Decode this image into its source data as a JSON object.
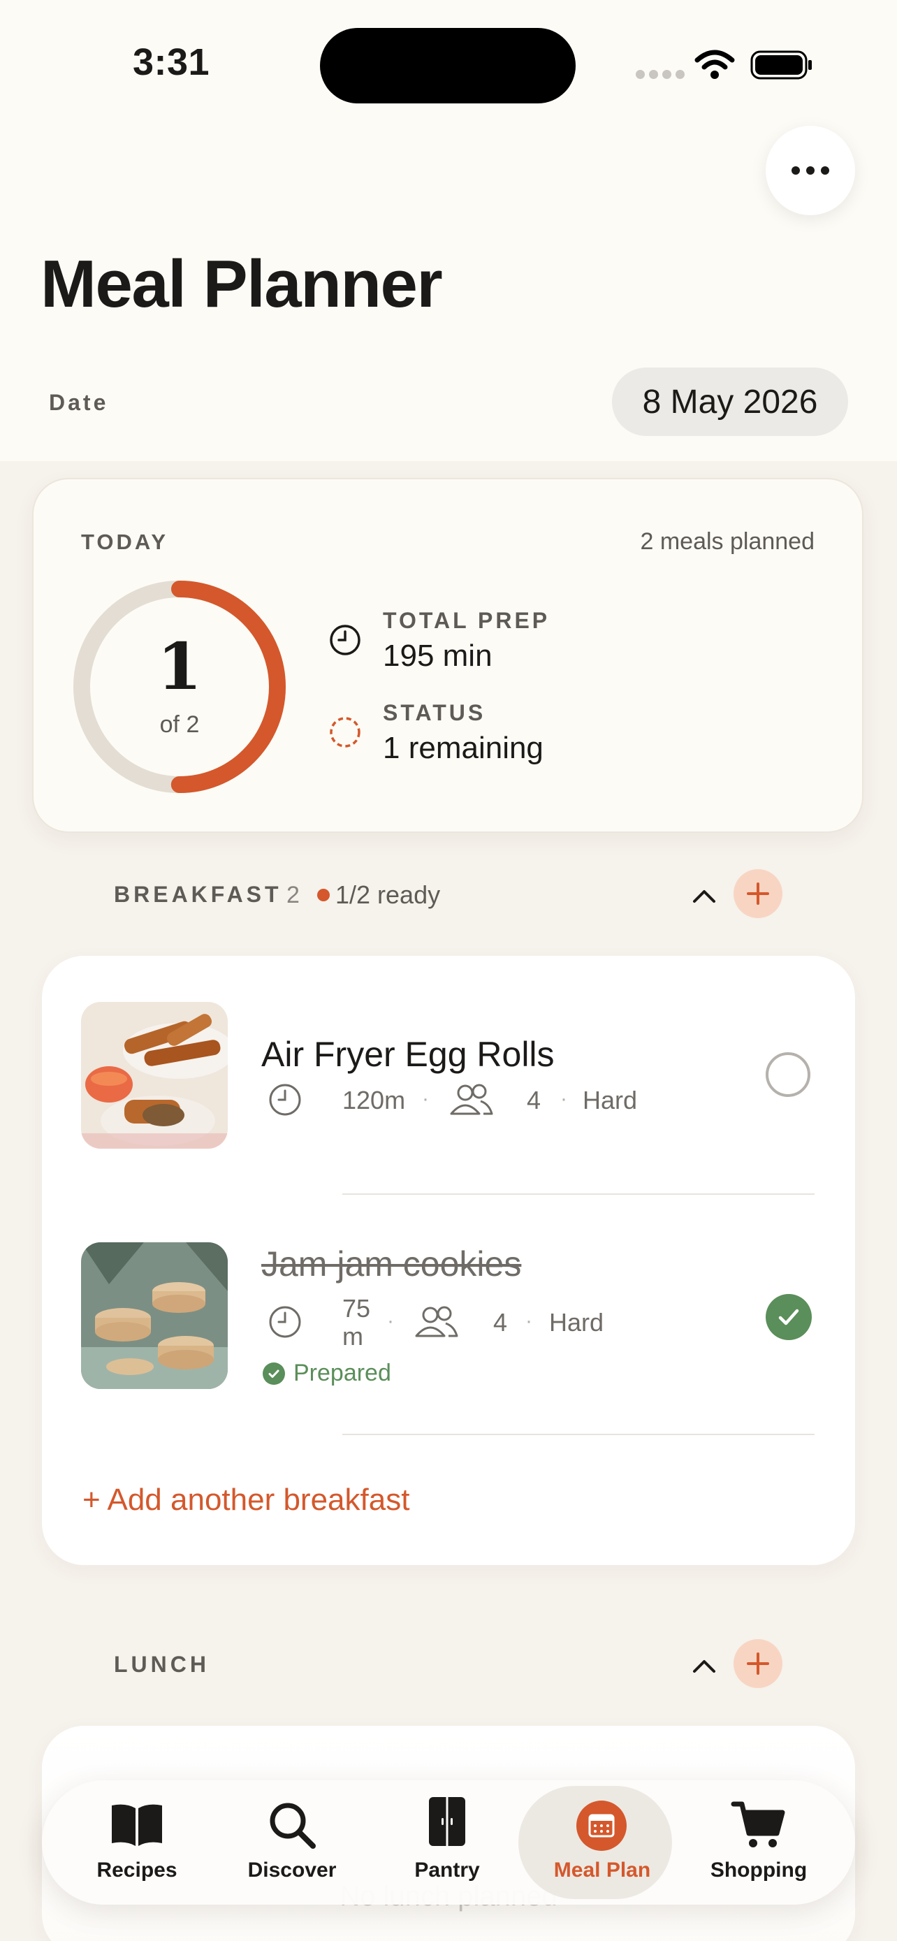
{
  "status_bar": {
    "time": "3:31"
  },
  "header": {
    "title": "Meal Planner",
    "date_label": "Date",
    "date_value": "8 May 2026"
  },
  "today": {
    "label": "TODAY",
    "meals_planned": "2 meals planned",
    "progress": {
      "done": "1",
      "of_text": "of 2",
      "fraction": 0.5
    },
    "total_prep_label": "TOTAL PREP",
    "total_prep_value": "195 min",
    "status_label": "STATUS",
    "status_value": "1 remaining"
  },
  "breakfast": {
    "title": "BREAKFAST",
    "count": "2",
    "ready": "1/2 ready",
    "meals": [
      {
        "name": "Air Fryer Egg Rolls",
        "time": "120m",
        "servings": "4",
        "difficulty": "Hard",
        "done": false
      },
      {
        "name": "Jam jam cookies",
        "time_line1": "75",
        "time_line2": "m",
        "servings": "4",
        "difficulty": "Hard",
        "done": true,
        "badge": "Prepared"
      }
    ],
    "add_label": "+ Add another breakfast"
  },
  "lunch": {
    "title": "LUNCH",
    "empty_hint": "No lunch planned"
  },
  "tabs": [
    {
      "label": "Recipes",
      "icon": "book-icon",
      "active": false
    },
    {
      "label": "Discover",
      "icon": "search-icon",
      "active": false
    },
    {
      "label": "Pantry",
      "icon": "pantry-icon",
      "active": false
    },
    {
      "label": "Meal Plan",
      "icon": "calendar-icon",
      "active": true
    },
    {
      "label": "Shopping",
      "icon": "cart-icon",
      "active": false
    }
  ],
  "colors": {
    "accent": "#d4582c",
    "accent_soft": "#f8d5c3",
    "success": "#5a8e5a",
    "background": "#f6f2ec"
  }
}
